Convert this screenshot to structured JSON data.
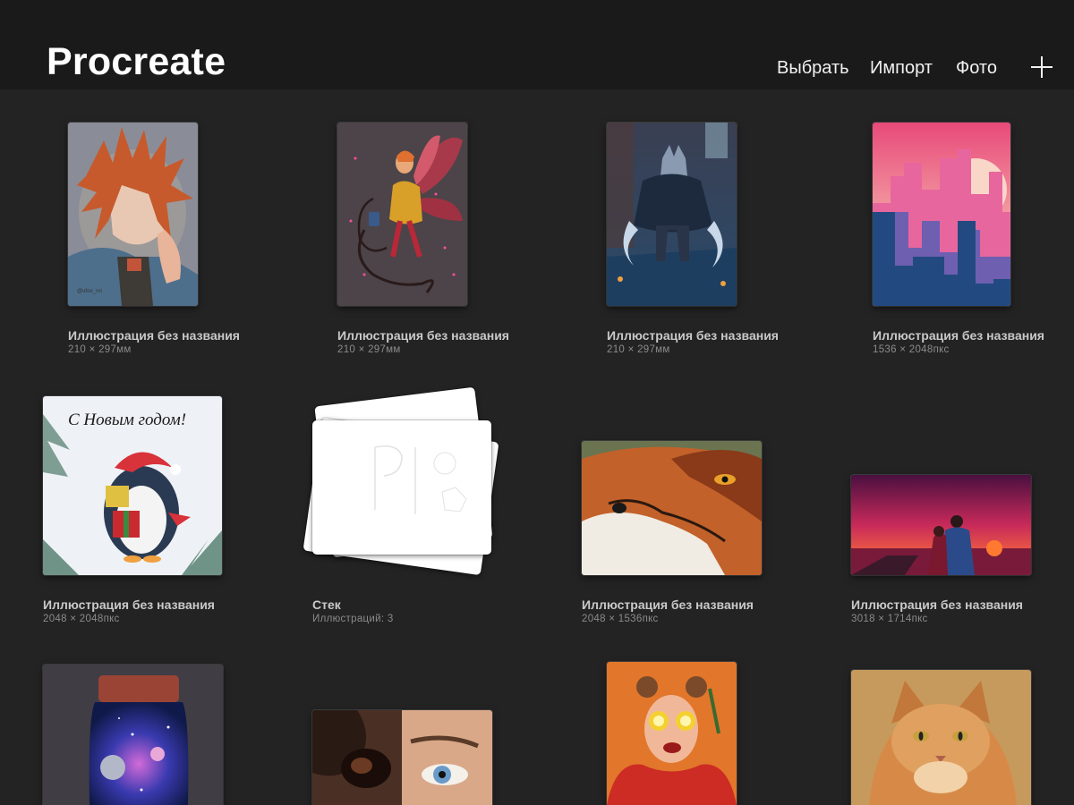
{
  "header": {
    "app_title": "Procreate",
    "select_label": "Выбрать",
    "import_label": "Импорт",
    "photo_label": "Фото",
    "add_icon": "plus-icon"
  },
  "gallery": {
    "items": [
      {
        "title": "Иллюстрация без названия",
        "subtitle": "210 × 297мм",
        "artwork": "anime boy with orange spiky hair"
      },
      {
        "title": "Иллюстрация без названия",
        "subtitle": "210 × 297мм",
        "artwork": "fairy with red wings and lantern"
      },
      {
        "title": "Иллюстрация без названия",
        "subtitle": "210 × 297мм",
        "artwork": "wolf warrior with blades"
      },
      {
        "title": "Иллюстрация без названия",
        "subtitle": "1536 × 2048пкс",
        "artwork": "pink city skyline"
      },
      {
        "title": "Иллюстрация без названия",
        "subtitle": "2048 × 2048пкс",
        "artwork": "penguin with gifts",
        "art_text": "С Новым годом!"
      },
      {
        "title": "Стек",
        "subtitle": "Иллюстраций: 3",
        "artwork": "stack of sketches"
      },
      {
        "title": "Иллюстрация без названия",
        "subtitle": "2048 × 1536пкс",
        "artwork": "fox portrait"
      },
      {
        "title": "Иллюстрация без названия",
        "subtitle": "3018 × 1714пкс",
        "artwork": "couple at sunset"
      },
      {
        "title": "",
        "subtitle": "",
        "artwork": "galaxy jar"
      },
      {
        "title": "",
        "subtitle": "",
        "artwork": "horse eye and human eye"
      },
      {
        "title": "",
        "subtitle": "",
        "artwork": "girl with lemon slices"
      },
      {
        "title": "",
        "subtitle": "",
        "artwork": "ginger cat"
      }
    ]
  },
  "colors": {
    "background": "#232323",
    "header_background": "#1a1a1a",
    "caption_title": "#c9c9c9",
    "caption_subtitle": "#8b8b8b"
  }
}
